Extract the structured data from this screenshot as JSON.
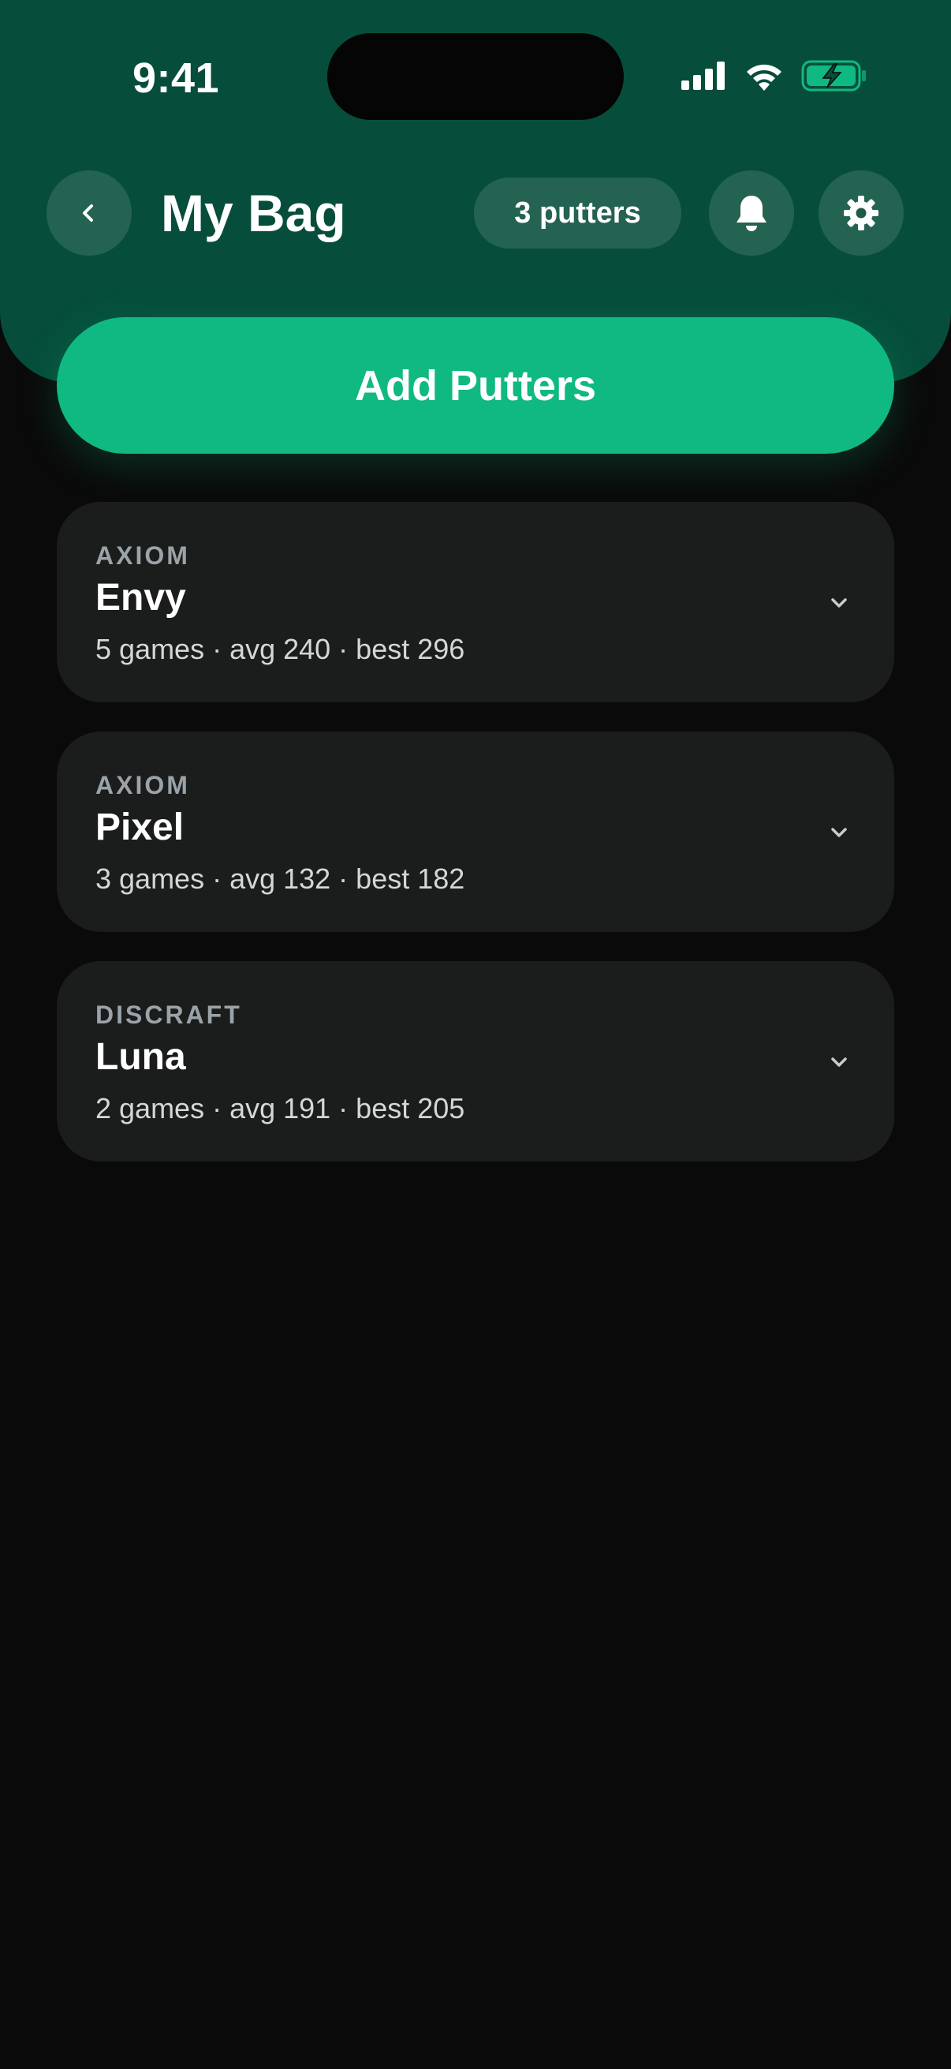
{
  "status_bar": {
    "time": "9:41"
  },
  "header": {
    "title": "My Bag",
    "count_label": "3 putters"
  },
  "actions": {
    "add_label": "Add Putters"
  },
  "putters": [
    {
      "brand": "AXIOM",
      "name": "Envy",
      "stats": "5 games · avg 240 · best 296"
    },
    {
      "brand": "AXIOM",
      "name": "Pixel",
      "stats": "3 games · avg 132 · best 182"
    },
    {
      "brand": "DISCRAFT",
      "name": "Luna",
      "stats": "2 games · avg 191 · best 205"
    }
  ],
  "icons": {
    "back": "chevron-left-icon",
    "bell": "bell-icon",
    "gear": "gear-icon",
    "expand": "chevron-down-icon"
  },
  "colors": {
    "header_bg": "#064e3b",
    "accent": "#10b981",
    "background": "#0a0a0a",
    "card_bg": "#1b1c1c",
    "muted_text": "#9aa3a8"
  }
}
